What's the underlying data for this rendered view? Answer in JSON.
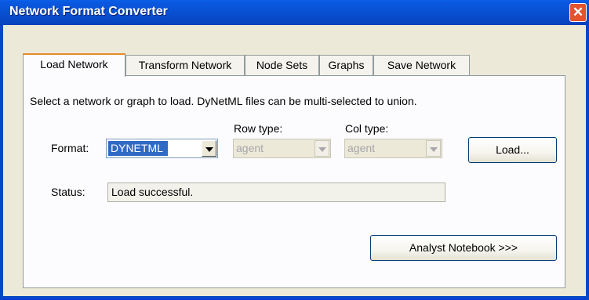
{
  "window": {
    "title": "Network Format Converter",
    "close_label": "✕"
  },
  "tabs": [
    {
      "label": "Load Network",
      "active": true
    },
    {
      "label": "Transform Network",
      "active": false
    },
    {
      "label": "Node Sets",
      "active": false
    },
    {
      "label": "Graphs",
      "active": false
    },
    {
      "label": "Save Network",
      "active": false
    }
  ],
  "panel": {
    "instruction": "Select a network or graph to load.  DyNetML files can be multi-selected to union.",
    "format_label": "Format:",
    "format_value": "DYNETML",
    "row_type_label": "Row type:",
    "row_type_value": "agent",
    "col_type_label": "Col type:",
    "col_type_value": "agent",
    "load_button": "Load...",
    "status_label": "Status:",
    "status_value": "Load successful.",
    "analyst_button": "Analyst Notebook >>>"
  },
  "colors": {
    "titlebar": "#0853d6",
    "close": "#e5522b",
    "active_tab_accent": "#e68b2c",
    "selection": "#316ac5"
  },
  "icons": {
    "close": "close-icon",
    "dropdown": "chevron-down-icon"
  }
}
